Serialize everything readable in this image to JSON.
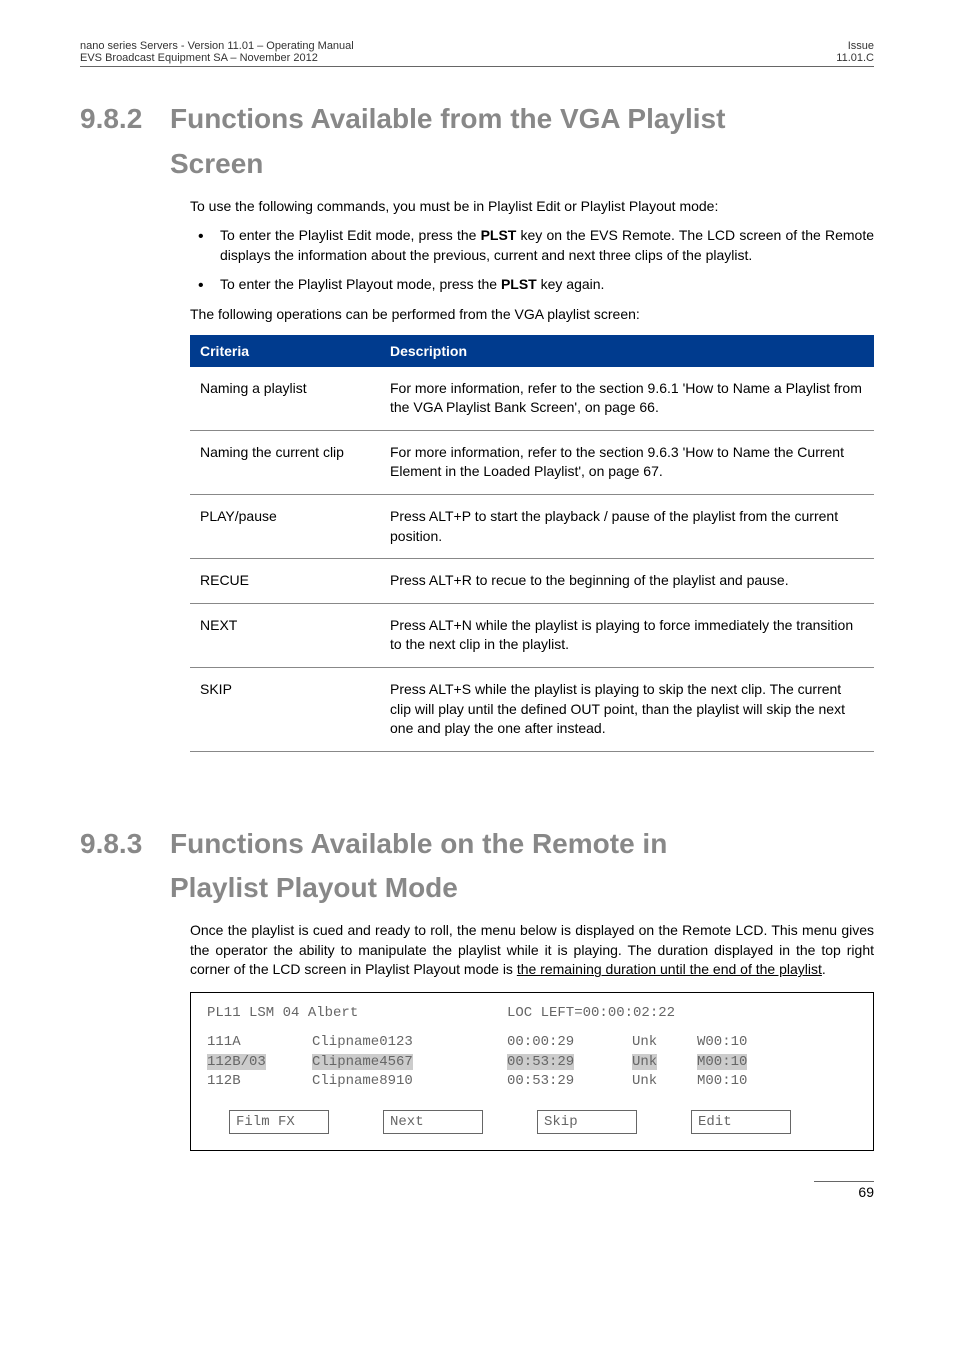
{
  "header": {
    "left_line1": "nano series Servers - Version 11.01 – Operating Manual",
    "left_line2": "EVS Broadcast Equipment SA – November 2012",
    "right_line1": "Issue",
    "right_line2": "11.01.C"
  },
  "section_982": {
    "num": "9.8.2",
    "title_line1": "Functions Available from the VGA Playlist",
    "title_line2": "Screen",
    "intro": "To use the following commands, you must be in Playlist Edit or Playlist Playout mode:",
    "bullets": [
      {
        "pre": "To enter the Playlist Edit mode, press the ",
        "bold": "PLST",
        "post": " key on the EVS Remote. The LCD screen of the Remote displays the information about the previous, current and next three clips of the playlist."
      },
      {
        "pre": "To enter the Playlist Playout mode, press the ",
        "bold": "PLST",
        "post": " key again."
      }
    ],
    "table_intro": "The following operations can be performed from the VGA playlist screen:",
    "table": {
      "head_c1": "Criteria",
      "head_c2": "Description",
      "rows": [
        {
          "c1": "Naming a playlist",
          "c2": "For more information, refer to the section 9.6.1 'How to Name a Playlist from the VGA Playlist Bank Screen', on page 66."
        },
        {
          "c1": "Naming the current clip",
          "c2": "For more information, refer to the section 9.6.3 'How to Name the Current Element in the Loaded Playlist', on page 67."
        },
        {
          "c1": "PLAY/pause",
          "c2": "Press ALT+P to start the playback / pause of the playlist from the current position."
        },
        {
          "c1": "RECUE",
          "c2": "Press ALT+R to recue to the beginning of the playlist and pause."
        },
        {
          "c1": "NEXT",
          "c2": "Press ALT+N while the playlist is playing to force immediately the transition to the next clip in the playlist."
        },
        {
          "c1": "SKIP",
          "c2": "Press ALT+S while the playlist is playing to skip the next clip. The current clip will play until the defined OUT point, than the playlist will skip the next one and play the one after instead."
        }
      ]
    }
  },
  "section_983": {
    "num": "9.8.3",
    "title_line1": "Functions Available on the Remote in",
    "title_line2": "Playlist Playout Mode",
    "para_pre": "Once the playlist is cued and ready to roll, the menu below is displayed on the Remote LCD. This menu gives the operator the ability to manipulate the playlist while it is playing. The duration displayed in the top right corner of the LCD screen in Playlist Playout mode is ",
    "para_under": "the remaining duration until the end of the playlist",
    "para_post": ".",
    "lcd": {
      "top_left": "PL11 LSM 04 Albert",
      "top_right": "LOC LEFT=00:00:02:22",
      "rows": [
        {
          "c1": "111A",
          "c2": "Clipname0123",
          "c3": "00:00:29",
          "c4": "Unk",
          "c5": "W00:10",
          "hl": false
        },
        {
          "c1": "112B/03",
          "c2": "Clipname4567",
          "c3": "00:53:29",
          "c4": "Unk",
          "c5": "M00:10",
          "hl": true
        },
        {
          "c1": "112B",
          "c2": "Clipname8910",
          "c3": "00:53:29",
          "c4": "Unk",
          "c5": "M00:10",
          "hl": false
        }
      ],
      "buttons": [
        "Film FX",
        "Next",
        "Skip",
        "Edit"
      ]
    }
  },
  "page_number": "69"
}
